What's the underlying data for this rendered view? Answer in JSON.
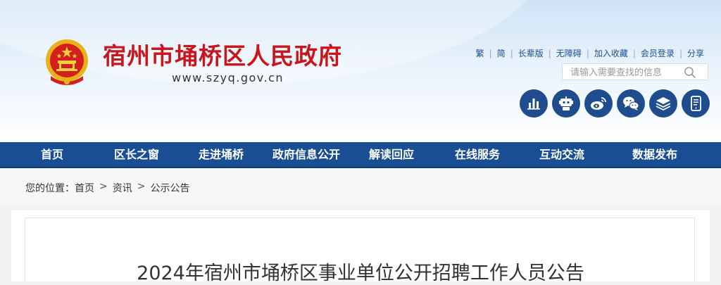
{
  "header": {
    "site_title": "宿州市埇桥区人民政府",
    "site_url": "www.szyq.gov.cn",
    "top_links": [
      "繁",
      "简",
      "长辈版",
      "无障碍",
      "加入收藏",
      "会员登录",
      "分享"
    ],
    "search": {
      "placeholder": "请输入需要查找的信息"
    },
    "quick_icons": [
      "data-chart-icon",
      "robot-icon",
      "weibo-icon",
      "wechat-icon",
      "layers-icon",
      "mobile-icon"
    ]
  },
  "nav": {
    "items": [
      "首页",
      "区长之窗",
      "走进埇桥",
      "政府信息公开",
      "解读回应",
      "在线服务",
      "互动交流",
      "数据发布"
    ]
  },
  "breadcrumb": {
    "prefix": "您的位置：",
    "items": [
      "首页",
      "资讯",
      "公示公告"
    ]
  },
  "article": {
    "title": "2024年宿州市埇桥区事业单位公开招聘工作人员公告"
  },
  "colors": {
    "brand_red": "#c8161d",
    "nav_blue": "#1a4e93",
    "icon_blue": "#1f4c8c"
  }
}
